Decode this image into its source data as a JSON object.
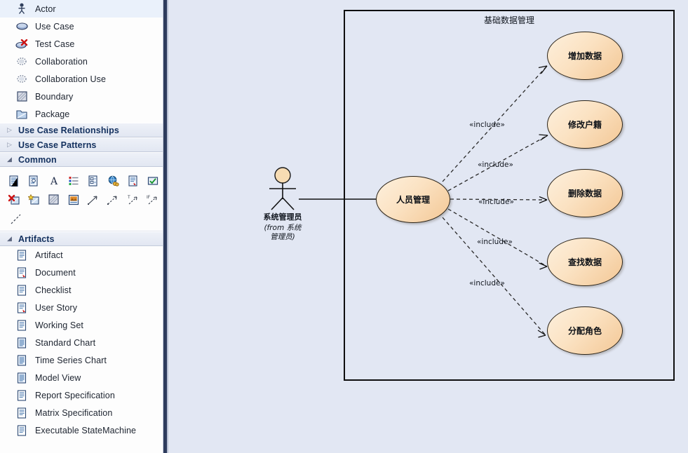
{
  "palette": {
    "groups": [
      {
        "type": "list",
        "items": [
          {
            "label": "Actor",
            "icon": "actor-icon"
          },
          {
            "label": "Use Case",
            "icon": "use-case-icon"
          },
          {
            "label": "Test Case",
            "icon": "test-case-icon"
          },
          {
            "label": "Collaboration",
            "icon": "collaboration-icon"
          },
          {
            "label": "Collaboration Use",
            "icon": "collaboration-use-icon"
          },
          {
            "label": "Boundary",
            "icon": "boundary-icon"
          },
          {
            "label": "Package",
            "icon": "package-icon"
          }
        ]
      }
    ],
    "sections": [
      {
        "title": "Use Case Relationships",
        "expanded": false,
        "triangle": "▷"
      },
      {
        "title": "Use Case Patterns",
        "expanded": false,
        "triangle": "▷"
      },
      {
        "title": "Common",
        "expanded": true,
        "triangle": "◢"
      },
      {
        "title": "Artifacts",
        "expanded": true,
        "triangle": "◢"
      }
    ],
    "common_icons": [
      [
        "note-icon",
        "note-link-icon",
        "text-icon",
        "legend-icon",
        "diagram-note-icon",
        "web-document-icon",
        "document-red-icon",
        "checkbox-green-icon"
      ],
      [
        "boundary-delete-icon",
        "boundary-new-icon",
        "hatch-boundary-icon",
        "image-icon",
        "connector-icon",
        "connector-arrow-icon",
        "trace-connector-icon",
        "if-connector-icon"
      ],
      [
        "dashed-connector-icon"
      ]
    ],
    "artifacts": [
      {
        "label": "Artifact",
        "icon": "artifact-icon"
      },
      {
        "label": "Document",
        "icon": "document-icon"
      },
      {
        "label": "Checklist",
        "icon": "checklist-icon"
      },
      {
        "label": "User Story",
        "icon": "user-story-icon"
      },
      {
        "label": "Working Set",
        "icon": "working-set-icon"
      },
      {
        "label": "Standard Chart",
        "icon": "standard-chart-icon"
      },
      {
        "label": "Time Series Chart",
        "icon": "time-series-chart-icon"
      },
      {
        "label": "Model View",
        "icon": "model-view-icon"
      },
      {
        "label": "Report Specification",
        "icon": "report-specification-icon"
      },
      {
        "label": "Matrix Specification",
        "icon": "matrix-specification-icon"
      },
      {
        "label": "Executable StateMachine",
        "icon": "executable-statemachine-icon"
      }
    ]
  },
  "diagram": {
    "frame_title": "基础数据管理",
    "actor": {
      "name": "系统管理员",
      "from_line1": "(from 系统",
      "from_line2": "管理员)"
    },
    "main_use_case": {
      "label": "人员管理"
    },
    "use_cases": [
      {
        "label": "增加数据"
      },
      {
        "label": "修改户籍"
      },
      {
        "label": "删除数据"
      },
      {
        "label": "查找数据"
      },
      {
        "label": "分配角色"
      }
    ],
    "include_labels": [
      "«include»",
      "«include»",
      "«include»",
      "«include»",
      "«include»"
    ],
    "colors": {
      "canvas": "#e2e7f3",
      "use_case_fill_light": "#fdf0dd",
      "use_case_fill_dark": "#f3c795",
      "use_case_stroke": "#2a2318",
      "frame_stroke": "#0e0e0e",
      "panel_edge": "#2e3c5d",
      "section_title": "#13305e"
    }
  }
}
